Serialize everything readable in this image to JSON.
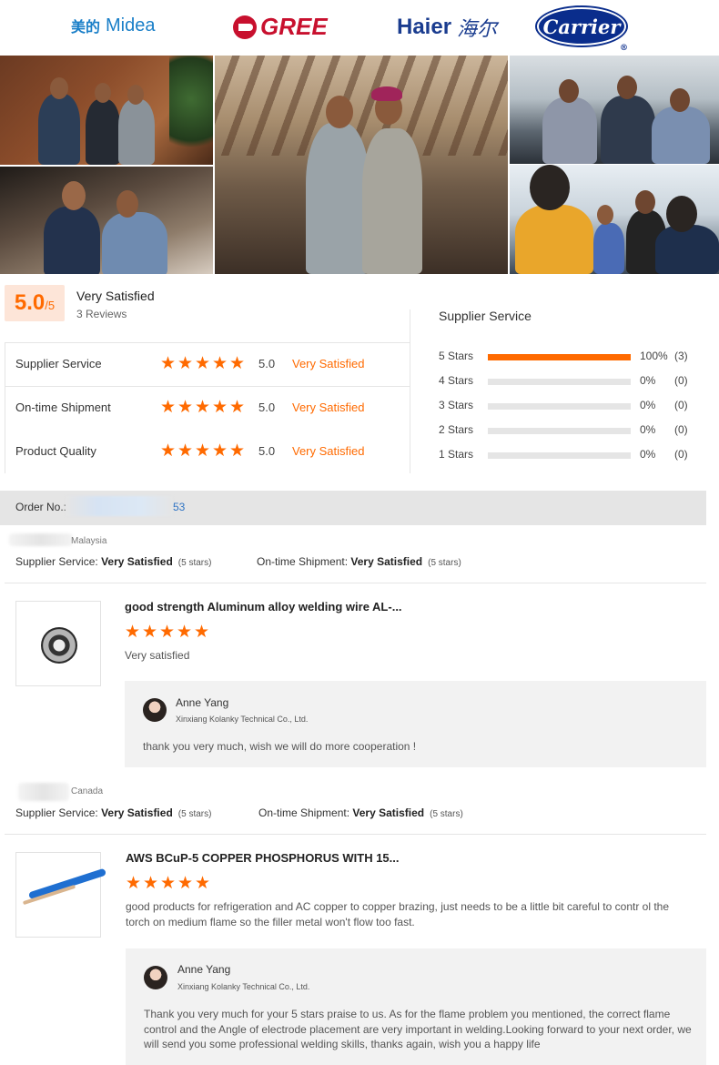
{
  "brands": {
    "midea_cn": "美的",
    "midea_en": "Midea",
    "gree": "GREE",
    "haier_en": "Haier",
    "haier_cn": "海尔",
    "carrier": "Carrier"
  },
  "summary": {
    "score": "5.0",
    "score_suffix": "/5",
    "title": "Very Satisfied",
    "reviews": "3 Reviews"
  },
  "categories": [
    {
      "label": "Supplier Service",
      "stars": 5,
      "score": "5.0",
      "text": "Very Satisfied"
    },
    {
      "label": "On-time Shipment",
      "stars": 5,
      "score": "5.0",
      "text": "Very Satisfied"
    },
    {
      "label": "Product Quality",
      "stars": 5,
      "score": "5.0",
      "text": "Very Satisfied"
    }
  ],
  "breakdown": {
    "title": "Supplier Service",
    "rows": [
      {
        "label": "5 Stars",
        "fraction": 1.0,
        "pct": "100%",
        "count": "(3)"
      },
      {
        "label": "4 Stars",
        "fraction": 0,
        "pct": "0%",
        "count": "(0)"
      },
      {
        "label": "3 Stars",
        "fraction": 0,
        "pct": "0%",
        "count": "(0)"
      },
      {
        "label": "2 Stars",
        "fraction": 0,
        "pct": "0%",
        "count": "(0)"
      },
      {
        "label": "1 Stars",
        "fraction": 0,
        "pct": "0%",
        "count": "(0)"
      }
    ]
  },
  "order": {
    "label": "Order No.:",
    "number_tail": "53"
  },
  "reviews": [
    {
      "country": "Malaysia",
      "supplier_label": "Supplier Service:",
      "supplier_value": "Very Satisfied",
      "supplier_stars": "(5 stars)",
      "shipment_label": "On-time Shipment:",
      "shipment_value": "Very Satisfied",
      "shipment_stars": "(5 stars)",
      "product_title": "good strength Aluminum alloy welding wire AL-...",
      "rating": 5,
      "comment": "Very satisfied",
      "reply_name": "Anne Yang",
      "reply_company": "Xinxiang Kolanky Technical Co., Ltd.",
      "reply_text": "thank you very much, wish we will do more cooperation !"
    },
    {
      "country": "Canada",
      "supplier_label": "Supplier Service:",
      "supplier_value": "Very Satisfied",
      "supplier_stars": "(5 stars)",
      "shipment_label": "On-time Shipment:",
      "shipment_value": "Very Satisfied",
      "shipment_stars": "(5 stars)",
      "product_title": "AWS BCuP-5 COPPER PHOSPHORUS WITH 15...",
      "rating": 5,
      "comment": "good products for refrigeration and AC copper to copper brazing, just needs to be a little bit careful to contr ol the torch on medium flame so the filler metal won't flow too fast.",
      "reply_name": "Anne Yang",
      "reply_company": "Xinxiang Kolanky Technical Co., Ltd.",
      "reply_text": "Thank you very much for your 5 stars praise to us. As for the flame problem you mentioned, the correct flame control and the Angle of electrode placement are very important in welding.Looking forward to your next order, we will send you some professional welding skills, thanks again, wish you a happy life"
    }
  ],
  "colors": {
    "accent": "#ff6a00",
    "midea": "#1a7fc8",
    "gree": "#c8102e",
    "haier": "#1a3c8f",
    "carrier": "#0a2d8c"
  }
}
